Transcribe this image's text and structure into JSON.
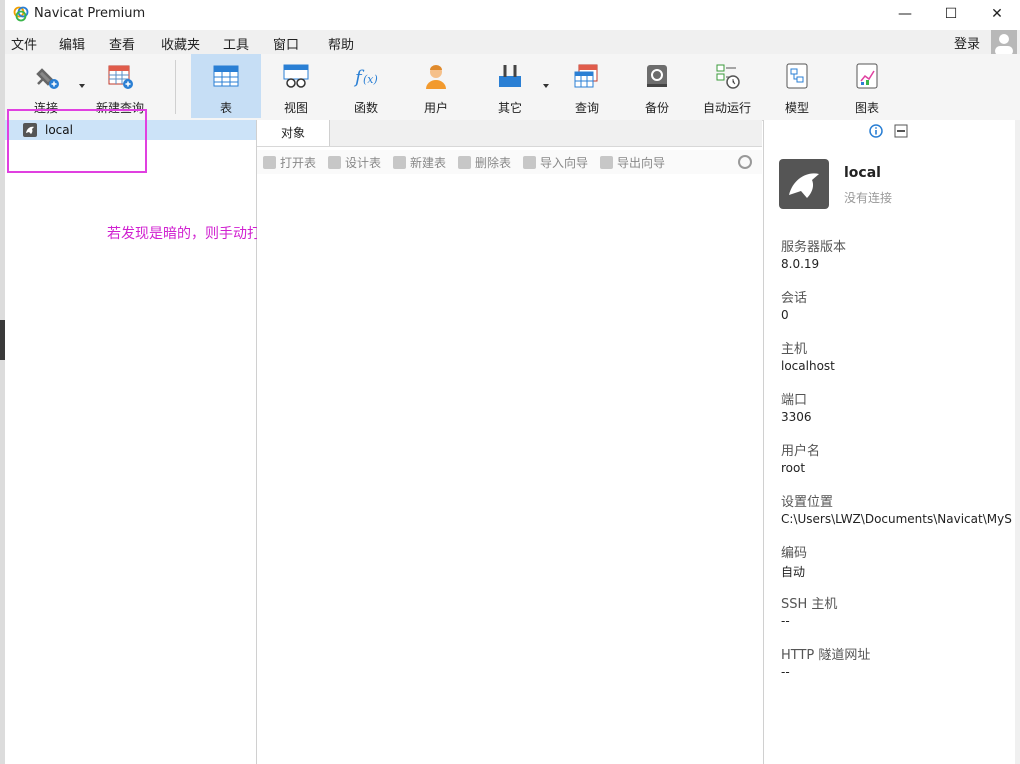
{
  "window": {
    "title": "Navicat Premium"
  },
  "window_controls": {
    "minimize": "—",
    "maximize": "☐",
    "close": "✕"
  },
  "menu": [
    "文件",
    "编辑",
    "查看",
    "收藏夹",
    "工具",
    "窗口",
    "帮助"
  ],
  "login_label": "登录",
  "toolbar": {
    "items": [
      {
        "label": "连接",
        "icon": "plug-icon",
        "has_dropdown": true
      },
      {
        "label": "新建查询",
        "icon": "new-query-icon"
      },
      {
        "label": "表",
        "icon": "table-icon",
        "active": true
      },
      {
        "label": "视图",
        "icon": "view-icon"
      },
      {
        "label": "函数",
        "icon": "function-icon"
      },
      {
        "label": "用户",
        "icon": "user-icon"
      },
      {
        "label": "其它",
        "icon": "tools-icon",
        "has_dropdown": true
      },
      {
        "label": "查询",
        "icon": "query-icon"
      },
      {
        "label": "备份",
        "icon": "backup-icon"
      },
      {
        "label": "自动运行",
        "icon": "auto-run-icon"
      },
      {
        "label": "模型",
        "icon": "model-icon"
      },
      {
        "label": "图表",
        "icon": "chart-icon"
      }
    ]
  },
  "tree": {
    "items": [
      {
        "label": "local",
        "icon": "mysql-dolphin-icon"
      }
    ]
  },
  "annotation": "若发现是暗的，则手动打开连接",
  "middle": {
    "tab_label": "对象",
    "object_toolbar": [
      "打开表",
      "设计表",
      "新建表",
      "删除表",
      "导入向导",
      "导出向导"
    ]
  },
  "info": {
    "connection_name": "local",
    "connection_status": "没有连接",
    "fields": [
      {
        "label": "服务器版本",
        "value": "8.0.19"
      },
      {
        "label": "会话",
        "value": "0"
      },
      {
        "label": "主机",
        "value": "localhost"
      },
      {
        "label": "端口",
        "value": "3306"
      },
      {
        "label": "用户名",
        "value": "root"
      },
      {
        "label": "设置位置",
        "value": "C:\\Users\\LWZ\\Documents\\Navicat\\MyS"
      },
      {
        "label": "编码",
        "value": "自动"
      },
      {
        "label": "SSH 主机",
        "value": "--"
      },
      {
        "label": "HTTP 隧道网址",
        "value": "--"
      }
    ]
  },
  "colors": {
    "accent_active": "#c6def5",
    "annotation": "#d020d0",
    "highlight_box": "#e040e0"
  }
}
